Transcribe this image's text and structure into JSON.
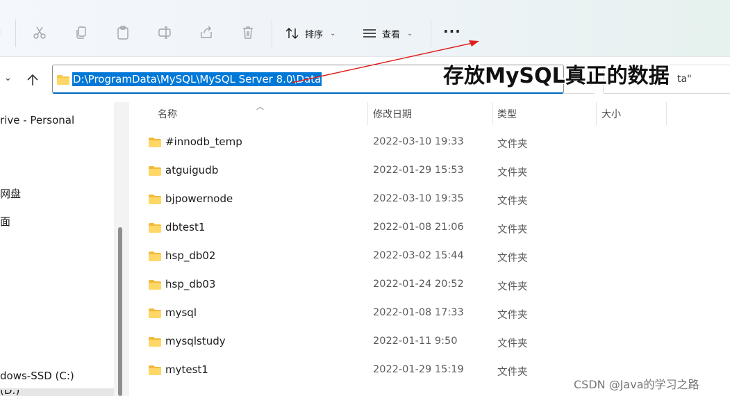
{
  "toolbar": {
    "sort_label": "排序",
    "view_label": "查看",
    "more_label": "···"
  },
  "address": {
    "path": "D:\\ProgramData\\MySQL\\MySQL Server 8.0\\Data",
    "search_partial": "ta\""
  },
  "annotation": {
    "text": "存放MySQL真正的数据"
  },
  "sidebar": {
    "items": [
      {
        "label": "rive - Personal"
      },
      {
        "label": "网盘"
      },
      {
        "label": "面"
      },
      {
        "label": "dows-SSD (C:)"
      },
      {
        "label": "(D:)"
      }
    ]
  },
  "columns": {
    "name": "名称",
    "date": "修改日期",
    "type": "类型",
    "size": "大小"
  },
  "rows": [
    {
      "name": "#innodb_temp",
      "date": "2022-03-10 19:33",
      "type": "文件夹"
    },
    {
      "name": "atguigudb",
      "date": "2022-01-29 15:53",
      "type": "文件夹"
    },
    {
      "name": "bjpowernode",
      "date": "2022-03-10 19:35",
      "type": "文件夹"
    },
    {
      "name": "dbtest1",
      "date": "2022-01-08 21:06",
      "type": "文件夹"
    },
    {
      "name": "hsp_db02",
      "date": "2022-03-02 15:44",
      "type": "文件夹"
    },
    {
      "name": "hsp_db03",
      "date": "2022-01-24 20:52",
      "type": "文件夹"
    },
    {
      "name": "mysql",
      "date": "2022-01-08 17:33",
      "type": "文件夹"
    },
    {
      "name": "mysqlstudy",
      "date": "2022-01-11 9:50",
      "type": "文件夹"
    },
    {
      "name": "mytest1",
      "date": "2022-01-29 15:19",
      "type": "文件夹"
    }
  ],
  "watermark": "CSDN @Java的学习之路",
  "colors": {
    "accent": "#0078d7",
    "folder": "#f8c94a",
    "arrow": "#e02020"
  }
}
